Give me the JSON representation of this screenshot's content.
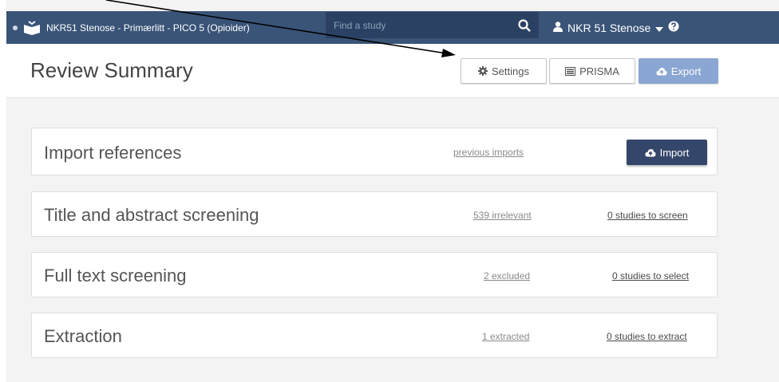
{
  "topbar": {
    "project_title": "NKR51 Stenose - Primærlitt - PICO 5 (Opioider)",
    "search_placeholder": "Find a study",
    "user_name": "NKR 51 Stenose"
  },
  "header": {
    "page_title": "Review Summary",
    "settings_label": "Settings",
    "prisma_label": "PRISMA",
    "export_label": "Export"
  },
  "steps": [
    {
      "title": "Import references",
      "link": "previous imports",
      "button": "Import"
    },
    {
      "title": "Title and abstract screening",
      "link": "539 irrelevant",
      "action": "0 studies to screen"
    },
    {
      "title": "Full text screening",
      "link": "2 excluded",
      "action": "0 studies to select"
    },
    {
      "title": "Extraction",
      "link": "1 extracted",
      "action": "0 studies to extract"
    }
  ],
  "colors": {
    "topbar": "#3a5478",
    "search": "#2a4163",
    "export_button": "#8aa6d2",
    "import_button": "#34476a"
  }
}
